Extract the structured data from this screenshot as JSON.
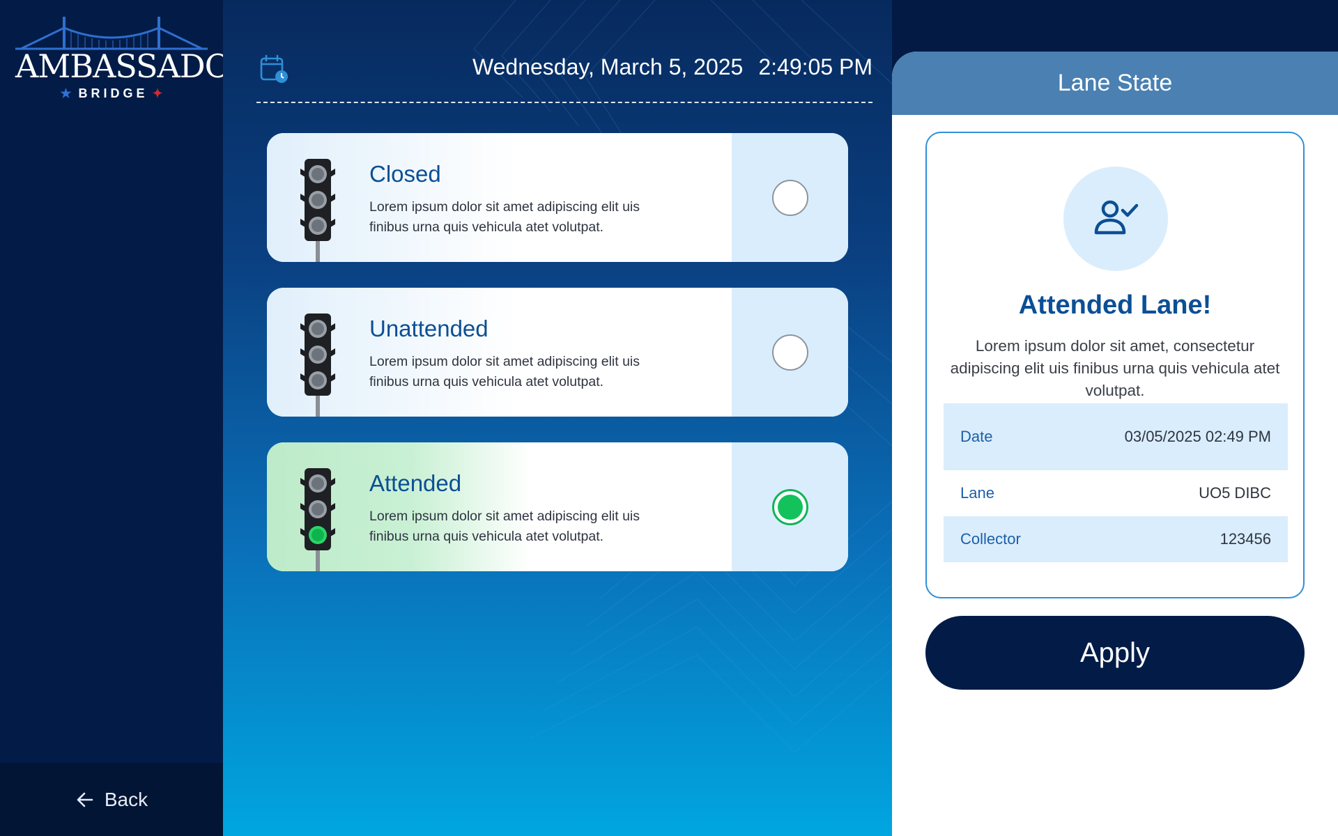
{
  "brand": {
    "name": "AMBASSADOR",
    "sub": "BRIDGE"
  },
  "sidebar": {
    "back_label": "Back"
  },
  "header": {
    "date": "Wednesday, March 5, 2025",
    "time": "2:49:05 PM"
  },
  "options": [
    {
      "title": "Closed",
      "desc": "Lorem ipsum dolor sit amet adipiscing elit uis finibus urna quis vehicula atet volutpat.",
      "selected": false
    },
    {
      "title": "Unattended",
      "desc": "Lorem ipsum dolor sit amet adipiscing elit uis finibus urna quis vehicula atet volutpat.",
      "selected": false
    },
    {
      "title": "Attended",
      "desc": "Lorem ipsum dolor sit amet adipiscing elit uis finibus urna quis vehicula atet volutpat.",
      "selected": true
    }
  ],
  "panel": {
    "title": "Lane State",
    "state_title": "Attended Lane!",
    "state_desc": "Lorem ipsum dolor sit amet, consectetur adipiscing elit uis finibus urna quis vehicula atet volutpat.",
    "rows": [
      {
        "label": "Date",
        "value": "03/05/2025 02:49 PM"
      },
      {
        "label": "Lane",
        "value": "UO5 DIBC"
      },
      {
        "label": "Collector",
        "value": "123456"
      }
    ],
    "apply_label": "Apply"
  },
  "colors": {
    "sidebar": "#031c47",
    "accent": "#0b4f95",
    "selected": "#13c25b",
    "panel_header": "#4a80b2"
  }
}
